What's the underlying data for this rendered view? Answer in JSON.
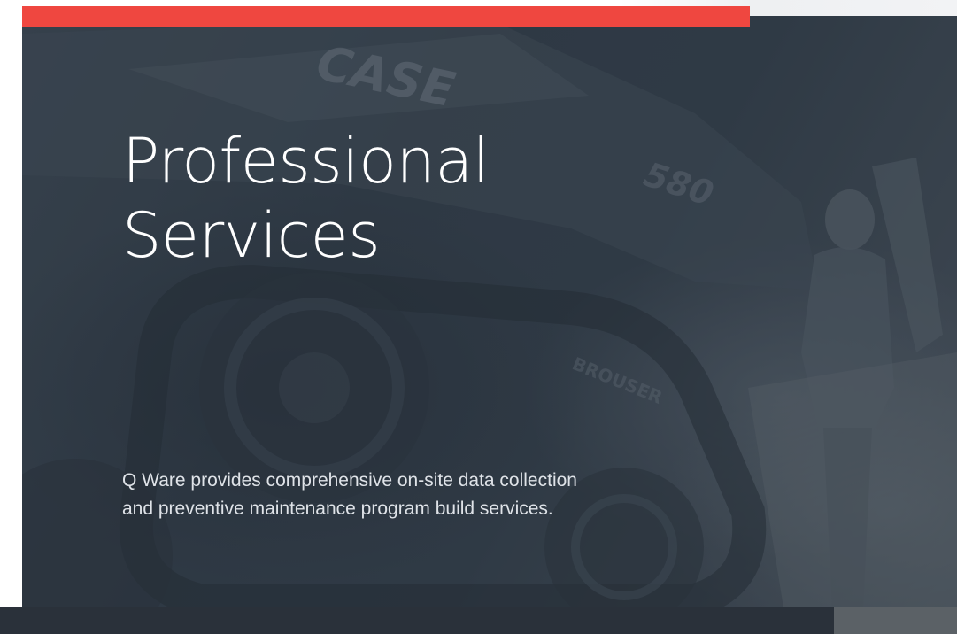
{
  "hero": {
    "title_line1": "Professional",
    "title_line2": "Services",
    "description_line1": "Q Ware provides comprehensive on-site data collection",
    "description_line2": "and preventive maintenance program build services.",
    "background_image": {
      "label_case": "CASE",
      "label_model": "580",
      "label_brand": "BROUSER"
    }
  },
  "colors": {
    "accent": "#ef4740",
    "hero_overlay": "#2f3944",
    "bottom_bar": "#2a313a",
    "text_primary": "#ffffff",
    "text_secondary": "#dfe3e8"
  }
}
